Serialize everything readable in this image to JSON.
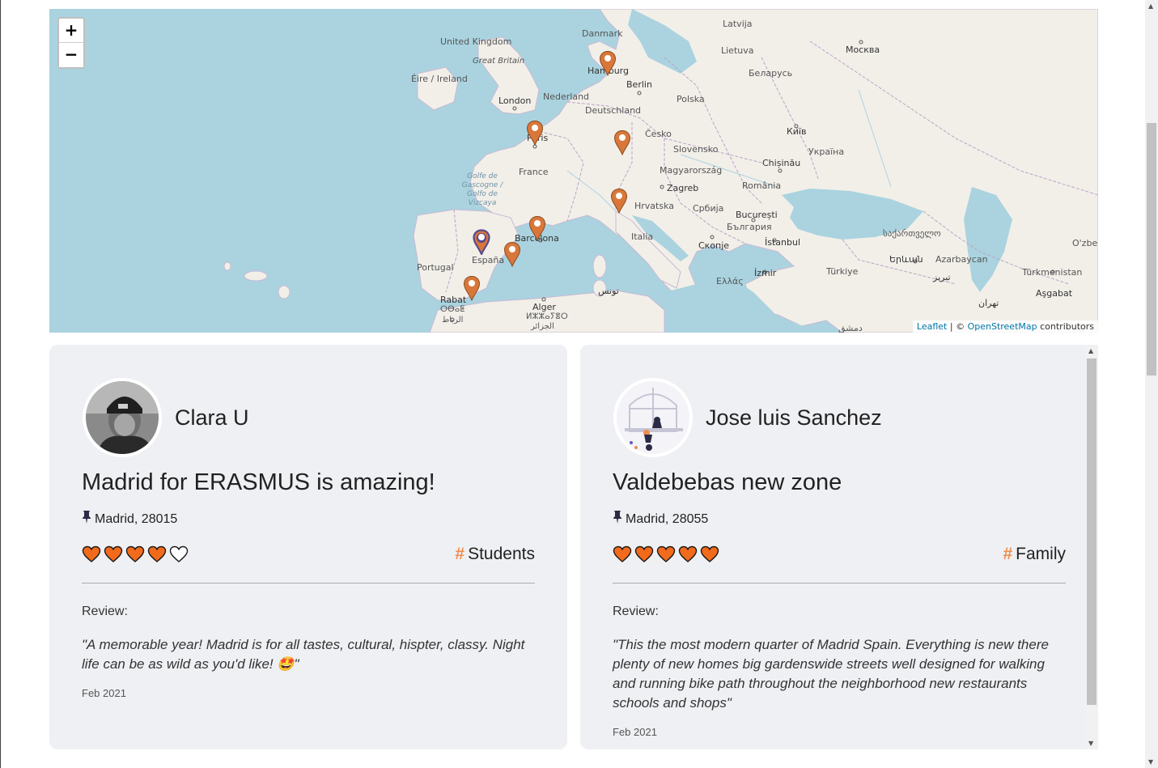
{
  "map": {
    "zoom_in_label": "+",
    "zoom_out_label": "−",
    "attribution": {
      "leaflet": "Leaflet",
      "separator": " | © ",
      "osm": "OpenStreetMap",
      "suffix": " contributors"
    },
    "places": {
      "latvija": "Latvija",
      "danmark": "Danmark",
      "lietuva": "Lietuva",
      "moskva": "Москва",
      "united_kingdom": "United Kingdom",
      "great_britain": "Great Britain",
      "eire": "Éire / Ireland",
      "hamburg": "Hamburg",
      "berlin": "Berlin",
      "belarus": "Беларусь",
      "nederland": "Nederland",
      "london": "London",
      "polska": "Polska",
      "deutschland": "Deutschland",
      "kyiv": "Київ",
      "paris": "Paris",
      "cesko": "Česko",
      "ukraina": "Україна",
      "slovensko": "Slovensko",
      "chisinau": "Chișinău",
      "france": "France",
      "golfe": "Golfe de Gascogne / Golfo de Vizcaya",
      "magyarorszag": "Magyarország",
      "zagreb": "Zagreb",
      "romania": "România",
      "hrvatska": "Hrvatska",
      "srbija": "Србија",
      "bucuresti": "București",
      "bulgaria": "България",
      "barcelona": "Barcelona",
      "georgia": "საქართველო",
      "espana": "España",
      "italia": "Italia",
      "skopje": "Скопје",
      "istanbul": "İstanbul",
      "ozbe": "O'zbe",
      "portugal": "Portugal",
      "yerevan": "Երևան",
      "azarbaycan": "Azarbaycan",
      "turkmenistan": "Türkmenistan",
      "izmir": "İzmir",
      "turkiye": "Türkiye",
      "tabriz": "تبریز",
      "ellada": "Ελλάς",
      "ashgabat": "Aşgabat",
      "tunis": "تونس",
      "rabat": "Rabat",
      "rabat_tfng": "ⵔⴱⴰⵟ",
      "rabat_ar": "الرباط",
      "alger": "Alger",
      "alger_tfng": "ⵍⵣⵣⴰⵢⴻⵔ",
      "alger_ar": "الجزائر",
      "tehran": "تهران",
      "dimashq": "دمشق"
    },
    "markers": [
      "hamburg",
      "paris",
      "munich",
      "milan",
      "barcelona",
      "madrid",
      "valencia",
      "sevilla"
    ]
  },
  "reviews": [
    {
      "author": "Clara U",
      "title": "Madrid for ERASMUS is amazing!",
      "location": "Madrid, 28015",
      "rating": 4,
      "max_rating": 5,
      "tag": "Students",
      "review_label": "Review:",
      "text": "\"A memorable year! Madrid is for all tastes, cultural, hispter, classy. Night life can be as wild as you'd like! 🤩\"",
      "date": "Feb 2021"
    },
    {
      "author": "Jose luis Sanchez",
      "title": "Valdebebas new zone",
      "location": "Madrid, 28055",
      "rating": 5,
      "max_rating": 5,
      "tag": "Family",
      "review_label": "Review:",
      "text": "\"This the most modern quarter of Madrid Spain. Everything is new there plenty of new homes big gardenswide streets well designed for walking and running bike path throughout the neighborhood new restaurants schools and shops\"",
      "date": "Feb 2021"
    }
  ],
  "colors": {
    "heart_fill": "#f26a1b",
    "heart_stroke": "#1b1b1b",
    "tag_hash": "#f08d4b",
    "marker": "#d9773a",
    "marker_active": "#5b4b8a",
    "sea": "#aad3df",
    "land": "#f2efe9",
    "card_bg": "#eff0f3"
  }
}
